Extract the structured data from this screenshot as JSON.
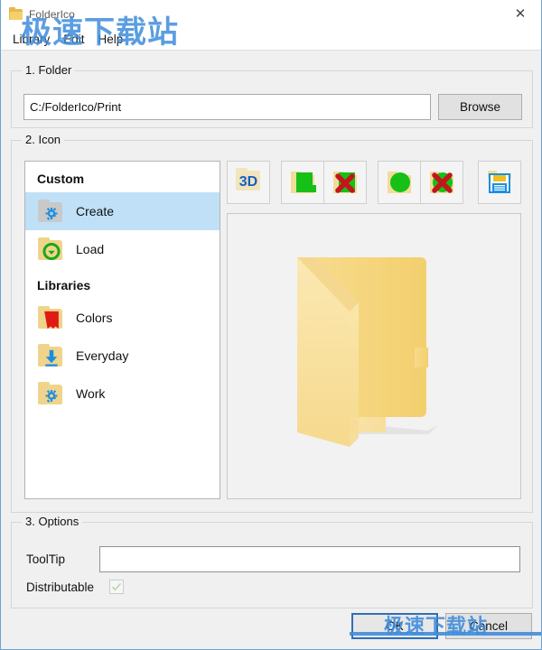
{
  "window": {
    "title": "FolderIco",
    "close_label": "✕",
    "title_icon": "folder-icon"
  },
  "menubar": {
    "items": [
      {
        "label": "Library"
      },
      {
        "label": "Edit"
      },
      {
        "label": "Help"
      }
    ]
  },
  "folder_section": {
    "title": "1. Folder",
    "path_value": "C:/FolderIco/Print",
    "path_placeholder": "",
    "browse_label": "Browse"
  },
  "icon_section": {
    "title": "2. Icon",
    "groups": [
      {
        "header": "Custom",
        "items": [
          {
            "label": "Create",
            "icon": "folder-gear-icon",
            "selected": true
          },
          {
            "label": "Load",
            "icon": "folder-download-icon",
            "selected": false
          }
        ]
      },
      {
        "header": "Libraries",
        "items": [
          {
            "label": "Colors",
            "icon": "folder-red-icon",
            "selected": false
          },
          {
            "label": "Everyday",
            "icon": "folder-arrow-down-icon",
            "selected": false
          },
          {
            "label": "Work",
            "icon": "folder-gear-blue-icon",
            "selected": false
          }
        ]
      }
    ],
    "toolbar": [
      {
        "name": "3d-button",
        "label": "3D"
      },
      {
        "name": "shape-square-button",
        "label": ""
      },
      {
        "name": "shape-square-remove-button",
        "label": ""
      },
      {
        "name": "shape-round-button",
        "label": ""
      },
      {
        "name": "shape-round-remove-button",
        "label": ""
      },
      {
        "name": "save-button",
        "label": ""
      }
    ],
    "preview": "folder-preview-yellow"
  },
  "options_section": {
    "title": "3. Options",
    "tooltip_label": "ToolTip",
    "tooltip_value": "",
    "tooltip_placeholder": "",
    "distributable_label": "Distributable",
    "distributable_checked": true
  },
  "buttons": {
    "ok_label": "OK",
    "cancel_label": "Cancel"
  },
  "watermark": {
    "text": "极速下载站",
    "text2": "极速下载站"
  },
  "colors": {
    "accent": "#3f8ddc",
    "selection": "#bfe0f7",
    "folder_yellow": "#f6d978",
    "dialog_bg": "#f0f0f0"
  }
}
